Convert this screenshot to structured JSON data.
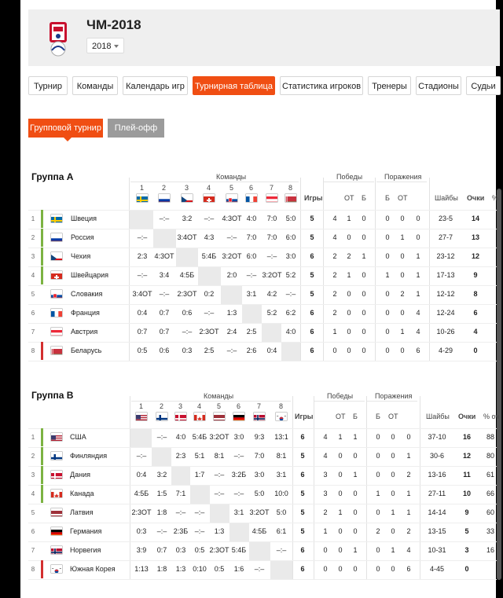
{
  "header": {
    "title": "ЧМ-2018",
    "year": "2018",
    "logo_text": "IIHF"
  },
  "tabs": [
    "Турнир",
    "Команды",
    "Календарь игр",
    "Турнирная таблица",
    "Статистика игроков",
    "Тренеры",
    "Стадионы",
    "Судьи"
  ],
  "active_tab": "Турнирная таблица",
  "subtabs": [
    "Групповой турнир",
    "Плей-офф"
  ],
  "active_subtab": "Групповой турнир",
  "column_labels": {
    "teams": "Команды",
    "games": "Игры",
    "wins": "Победы",
    "losses": "Поражения",
    "goals": "Шайбы",
    "points": "Очки",
    "pct": "%",
    "pct_full": "% оч",
    "ot": "ОТ",
    "b": "Б"
  },
  "groups": [
    {
      "title": "Группа А",
      "head_flags": [
        "flag-sweden",
        "flag-russia",
        "flag-czech",
        "flag-switzerland",
        "flag-slovakia",
        "flag-france",
        "flag-austria",
        "flag-belarus"
      ],
      "rows": [
        {
          "rank": "1",
          "marker": "green",
          "flag": "flag-sweden",
          "name": "Швеция",
          "results": [
            "",
            "–:–",
            "3:2",
            "–:–",
            "4:3ОТ",
            "4:0",
            "7:0",
            "5:0"
          ],
          "games": "5",
          "w": "4",
          "wot": "1",
          "wb": "0",
          "lb": "0",
          "lot": "0",
          "l": "0",
          "goals": "23-5",
          "pts": "14",
          "pct": ""
        },
        {
          "rank": "2",
          "marker": "green",
          "flag": "flag-russia",
          "name": "Россия",
          "results": [
            "–:–",
            "",
            "3:4ОТ",
            "4:3",
            "–:–",
            "7:0",
            "7:0",
            "6:0"
          ],
          "games": "5",
          "w": "4",
          "wot": "0",
          "wb": "0",
          "lb": "0",
          "lot": "1",
          "l": "0",
          "goals": "27-7",
          "pts": "13",
          "pct": ""
        },
        {
          "rank": "3",
          "marker": "green",
          "flag": "flag-czech",
          "name": "Чехия",
          "results": [
            "2:3",
            "4:3ОТ",
            "",
            "5:4Б",
            "3:2ОТ",
            "6:0",
            "–:–",
            "3:0"
          ],
          "games": "6",
          "w": "2",
          "wot": "2",
          "wb": "1",
          "lb": "0",
          "lot": "0",
          "l": "1",
          "goals": "23-12",
          "pts": "12",
          "pct": ""
        },
        {
          "rank": "4",
          "marker": "green",
          "flag": "flag-switzerland",
          "name": "Швейцария",
          "results": [
            "–:–",
            "3:4",
            "4:5Б",
            "",
            "2:0",
            "–:–",
            "3:2ОТ",
            "5:2"
          ],
          "games": "5",
          "w": "2",
          "wot": "1",
          "wb": "0",
          "lb": "1",
          "lot": "0",
          "l": "1",
          "goals": "17-13",
          "pts": "9",
          "pct": ""
        },
        {
          "rank": "5",
          "marker": "none",
          "flag": "flag-slovakia",
          "name": "Словакия",
          "results": [
            "3:4ОТ",
            "–:–",
            "2:3ОТ",
            "0:2",
            "",
            "3:1",
            "4:2",
            "–:–"
          ],
          "games": "5",
          "w": "2",
          "wot": "0",
          "wb": "0",
          "lb": "0",
          "lot": "2",
          "l": "1",
          "goals": "12-12",
          "pts": "8",
          "pct": ""
        },
        {
          "rank": "6",
          "marker": "none",
          "flag": "flag-france",
          "name": "Франция",
          "results": [
            "0:4",
            "0:7",
            "0:6",
            "–:–",
            "1:3",
            "",
            "5:2",
            "6:2"
          ],
          "games": "6",
          "w": "2",
          "wot": "0",
          "wb": "0",
          "lb": "0",
          "lot": "0",
          "l": "4",
          "goals": "12-24",
          "pts": "6",
          "pct": ""
        },
        {
          "rank": "7",
          "marker": "none",
          "flag": "flag-austria",
          "name": "Австрия",
          "results": [
            "0:7",
            "0:7",
            "–:–",
            "2:3ОТ",
            "2:4",
            "2:5",
            "",
            "4:0"
          ],
          "games": "6",
          "w": "1",
          "wot": "0",
          "wb": "0",
          "lb": "0",
          "lot": "1",
          "l": "4",
          "goals": "10-26",
          "pts": "4",
          "pct": ""
        },
        {
          "rank": "8",
          "marker": "red",
          "flag": "flag-belarus",
          "name": "Беларусь",
          "results": [
            "0:5",
            "0:6",
            "0:3",
            "2:5",
            "–:–",
            "2:6",
            "0:4",
            ""
          ],
          "games": "6",
          "w": "0",
          "wot": "0",
          "wb": "0",
          "lb": "0",
          "lot": "0",
          "l": "6",
          "goals": "4-29",
          "pts": "0",
          "pct": ""
        }
      ]
    },
    {
      "title": "Группа B",
      "head_flags": [
        "flag-usa",
        "flag-finland",
        "flag-denmark",
        "flag-canada",
        "flag-latvia",
        "flag-germany",
        "flag-norway",
        "flag-korea"
      ],
      "rows": [
        {
          "rank": "1",
          "marker": "green",
          "flag": "flag-usa",
          "name": "США",
          "results": [
            "",
            "–:–",
            "4:0",
            "5:4Б",
            "3:2ОТ",
            "3:0",
            "9:3",
            "13:1"
          ],
          "games": "6",
          "w": "4",
          "wot": "1",
          "wb": "1",
          "lb": "0",
          "lot": "0",
          "l": "0",
          "goals": "37-10",
          "pts": "16",
          "pct": "88"
        },
        {
          "rank": "2",
          "marker": "green",
          "flag": "flag-finland",
          "name": "Финляндия",
          "results": [
            "–:–",
            "",
            "2:3",
            "5:1",
            "8:1",
            "–:–",
            "7:0",
            "8:1"
          ],
          "games": "5",
          "w": "4",
          "wot": "0",
          "wb": "0",
          "lb": "0",
          "lot": "0",
          "l": "1",
          "goals": "30-6",
          "pts": "12",
          "pct": "80"
        },
        {
          "rank": "3",
          "marker": "green",
          "flag": "flag-denmark",
          "name": "Дания",
          "results": [
            "0:4",
            "3:2",
            "",
            "1:7",
            "–:–",
            "3:2Б",
            "3:0",
            "3:1"
          ],
          "games": "6",
          "w": "3",
          "wot": "0",
          "wb": "1",
          "lb": "0",
          "lot": "0",
          "l": "2",
          "goals": "13-16",
          "pts": "11",
          "pct": "61"
        },
        {
          "rank": "4",
          "marker": "green",
          "flag": "flag-canada",
          "name": "Канада",
          "results": [
            "4:5Б",
            "1:5",
            "7:1",
            "",
            "–:–",
            "–:–",
            "5:0",
            "10:0"
          ],
          "games": "5",
          "w": "3",
          "wot": "0",
          "wb": "0",
          "lb": "1",
          "lot": "0",
          "l": "1",
          "goals": "27-11",
          "pts": "10",
          "pct": "66"
        },
        {
          "rank": "5",
          "marker": "none",
          "flag": "flag-latvia",
          "name": "Латвия",
          "results": [
            "2:3ОТ",
            "1:8",
            "–:–",
            "–:–",
            "",
            "3:1",
            "3:2ОТ",
            "5:0"
          ],
          "games": "5",
          "w": "2",
          "wot": "1",
          "wb": "0",
          "lb": "0",
          "lot": "1",
          "l": "1",
          "goals": "14-14",
          "pts": "9",
          "pct": "60"
        },
        {
          "rank": "6",
          "marker": "none",
          "flag": "flag-germany",
          "name": "Германия",
          "results": [
            "0:3",
            "–:–",
            "2:3Б",
            "–:–",
            "1:3",
            "",
            "4:5Б",
            "6:1"
          ],
          "games": "5",
          "w": "1",
          "wot": "0",
          "wb": "0",
          "lb": "2",
          "lot": "0",
          "l": "2",
          "goals": "13-15",
          "pts": "5",
          "pct": "33"
        },
        {
          "rank": "7",
          "marker": "none",
          "flag": "flag-norway",
          "name": "Норвегия",
          "results": [
            "3:9",
            "0:7",
            "0:3",
            "0:5",
            "2:3ОТ",
            "5:4Б",
            "",
            "–:–"
          ],
          "games": "6",
          "w": "0",
          "wot": "0",
          "wb": "1",
          "lb": "0",
          "lot": "1",
          "l": "4",
          "goals": "10-31",
          "pts": "3",
          "pct": "16"
        },
        {
          "rank": "8",
          "marker": "red",
          "flag": "flag-korea",
          "name": "Южная Корея",
          "results": [
            "1:13",
            "1:8",
            "1:3",
            "0:10",
            "0:5",
            "1:6",
            "–:–",
            ""
          ],
          "games": "6",
          "w": "0",
          "wot": "0",
          "wb": "0",
          "lb": "0",
          "lot": "0",
          "l": "6",
          "goals": "4-45",
          "pts": "0",
          "pct": ""
        }
      ]
    }
  ],
  "colors": {
    "accent": "#f04e13",
    "qualified": "#7cb342",
    "relegated": "#d32f2f",
    "inactive_tab": "#9b9b9b"
  }
}
